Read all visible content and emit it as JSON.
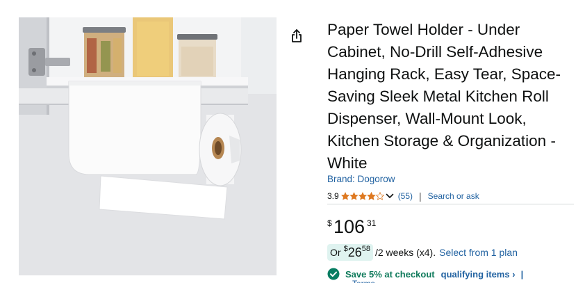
{
  "product": {
    "title": "Paper Towel Holder - Under Cabinet, No-Drill Self-Adhesive Hanging Rack, Easy Tear, Space-Saving Sleek Metal Kitchen Roll Dispenser, Wall-Mount Look, Kitchen Storage & Organization - White",
    "brand_link": "Brand: Dogorow",
    "rating": "3.9",
    "rating_stars_value": 3.9,
    "rating_count": "(55)",
    "separator": "|",
    "search_link": "Search or ask",
    "image_icon": "product-photo",
    "share_icon": "share-icon"
  },
  "price": {
    "symbol": "$",
    "whole": "106",
    "fraction": "31"
  },
  "installment": {
    "prefix": "Or",
    "symbol": "$",
    "whole": "26",
    "fraction": "58",
    "term": "/2 weeks (x4).",
    "link": "Select from 1 plan"
  },
  "coupon": {
    "icon": "check-circle-icon",
    "save_text": "Save 5% at checkout",
    "qualifying_link": "qualifying items",
    "chevron": "›",
    "bar": "|",
    "cut_text": "Terms"
  },
  "colors": {
    "link": "#2162a1",
    "star": "#de7921",
    "check": "#067d62",
    "badge_bg": "#dff3f0"
  }
}
